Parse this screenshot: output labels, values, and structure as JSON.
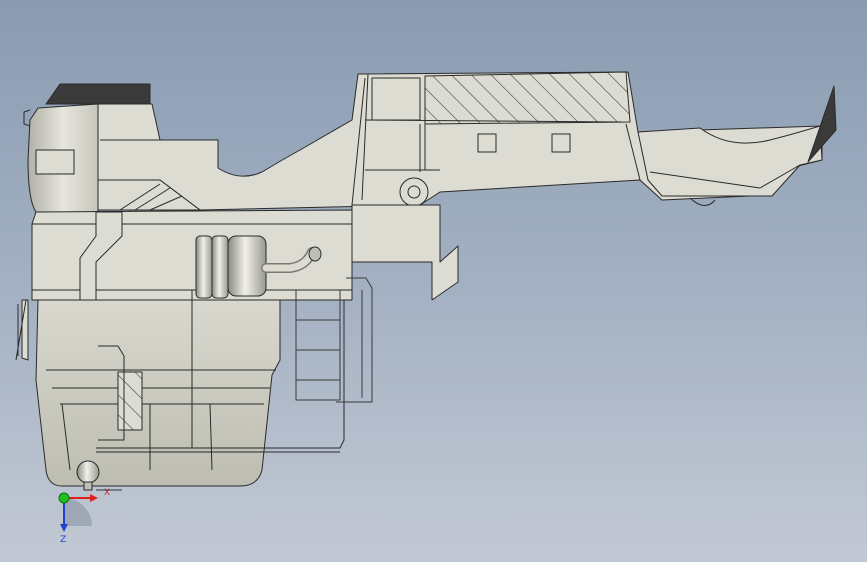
{
  "viewport": {
    "background_top": "#8a9cb2",
    "background_bottom": "#c2c9d4",
    "model_fill": "#dcdcd2",
    "model_edge": "#2a2a2a",
    "dark_panel": "#3a3a3a"
  },
  "triad": {
    "x_label": "X",
    "y_label": "",
    "z_label": "Z",
    "x_color": "#e02020",
    "y_color": "#20c020",
    "z_color": "#2040d0"
  }
}
